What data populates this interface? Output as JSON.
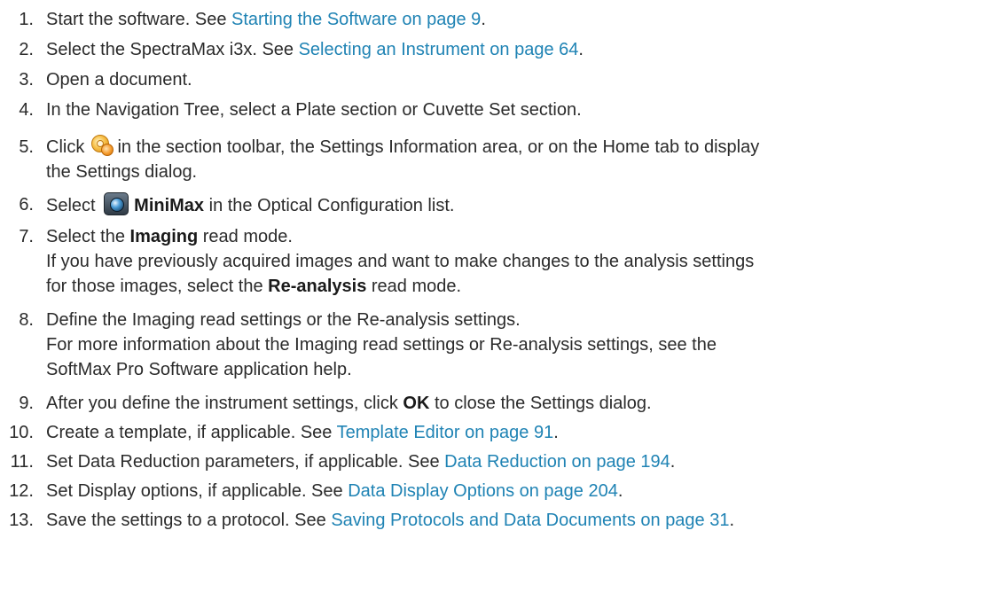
{
  "steps": [
    {
      "num": "1.",
      "pre": "Start the software. See ",
      "link": "Starting the Software on page 9",
      "post": "."
    },
    {
      "num": "2.",
      "pre": "Select the SpectraMax i3x. See ",
      "link": "Selecting an Instrument on page 64",
      "post": "."
    },
    {
      "num": "3.",
      "text": "Open a document."
    },
    {
      "num": "4.",
      "text": "In the Navigation Tree, select a Plate section or Cuvette Set section."
    },
    {
      "num": "5.",
      "pre": "Click ",
      "post": " in the section toolbar, the Settings Information area, or on the Home tab to display",
      "line2": "the Settings dialog.",
      "icon": "settings-gear-icon"
    },
    {
      "num": "6.",
      "pre": "Select ",
      "bold": "MiniMax",
      "post": " in the Optical Configuration list.",
      "icon": "minimax-camera-icon"
    },
    {
      "num": "7.",
      "pre": "Select the ",
      "bold": "Imaging",
      "post": " read mode.",
      "sub1": "If you have previously acquired images and want to make changes to the analysis settings",
      "sub2_pre": "for those images, select the ",
      "sub2_bold": "Re-analysis",
      "sub2_post": " read mode."
    },
    {
      "num": "8.",
      "text": "Define the Imaging read settings or the Re-analysis settings.",
      "sub1": "For more information about the Imaging read settings or Re-analysis settings, see the",
      "sub2": "SoftMax Pro Software application help."
    },
    {
      "num": "9.",
      "pre": "After you define the instrument settings, click ",
      "bold": "OK",
      "post": " to close the Settings dialog."
    },
    {
      "num": "10.",
      "pre": "Create a template, if applicable. See ",
      "link": "Template Editor on page 91",
      "post": "."
    },
    {
      "num": "11.",
      "pre": "Set Data Reduction parameters, if applicable. See ",
      "link": "Data Reduction on page 194",
      "post": "."
    },
    {
      "num": "12.",
      "pre": "Set Display options, if applicable. See ",
      "link": "Data Display Options on page 204",
      "post": "."
    },
    {
      "num": "13.",
      "pre": "Save the settings to a protocol. See ",
      "link": "Saving Protocols and Data Documents on page 31",
      "post": "."
    }
  ],
  "colors": {
    "text": "#2b2b2b",
    "link": "#1f83b4"
  }
}
